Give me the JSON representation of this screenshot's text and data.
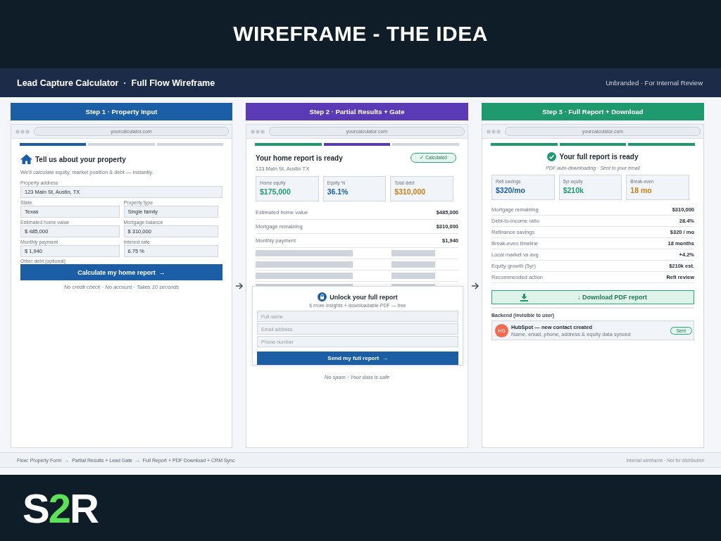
{
  "slide": {
    "title": "WIREFRAME - THE IDEA",
    "logo": [
      {
        "text": "S",
        "accent": false
      },
      {
        "text": "2",
        "accent": true
      },
      {
        "text": "R",
        "accent": false
      }
    ]
  },
  "header": {
    "title": "Lead Capture Calculator  ·  Full Flow Wireframe",
    "note": "Unbranded · For Internal Review"
  },
  "steps": [
    {
      "kind": "form",
      "title": "Step 1 · Property Input",
      "color": "#1b5ea6",
      "url": "yourcalculator.com",
      "progress": [
        {
          "color": "#1b5ea6"
        },
        {
          "color": "#d0d7e2"
        },
        {
          "color": "#d0d7e2"
        }
      ],
      "heading": "Tell us about your property",
      "subtitle": "We'll calculate equity, market position & debt — instantly.",
      "field_rows": [
        [
          {
            "label": "Property address",
            "value": "123 Main St, Austin, TX"
          }
        ],
        [
          {
            "label": "State",
            "value": "Texas"
          },
          {
            "label": "Property type",
            "value": "Single family"
          }
        ],
        [
          {
            "label": "Estimated home value",
            "value": "$ 485,000"
          },
          {
            "label": "Mortgage balance",
            "value": "$ 310,000"
          }
        ],
        [
          {
            "label": "Monthly payment",
            "value": "$ 1,940"
          },
          {
            "label": "Interest rate",
            "value": "6.75 %"
          }
        ]
      ],
      "extra_label": "Other debt (optional)",
      "button": "Calculate my home report  →",
      "note": "No credit check · No account · Takes 10 seconds"
    },
    {
      "kind": "gate",
      "title": "Step 2 · Partial Results + Gate",
      "color": "#5b3bb5",
      "url": "yourcalculator.com",
      "progress": [
        {
          "color": "#1f9a6e"
        },
        {
          "color": "#5b3bb5"
        },
        {
          "color": "#d0d7e2"
        }
      ],
      "heading": "Your home report is ready",
      "badge": "✓ Calculated",
      "address": "123 Main St, Austin TX",
      "stats": [
        {
          "label": "Home equity",
          "value": "$175,000",
          "color": "#1f9a6e"
        },
        {
          "label": "Equity %",
          "value": "36.1%",
          "color": "#1b5ea6"
        },
        {
          "label": "Total debt",
          "value": "$310,000",
          "color": "#c9821a"
        }
      ],
      "rows": [
        {
          "label": "Estimated home value",
          "value": "$485,000"
        },
        {
          "label": "Mortgage remaining",
          "value": "$310,000"
        },
        {
          "label": "Monthly payment",
          "value": "$1,940"
        }
      ],
      "gate": {
        "title": "Unlock your full report",
        "subtitle": "6 more insights + downloadable PDF — free",
        "fields": [
          {
            "placeholder": "Full name"
          },
          {
            "placeholder": "Email address"
          },
          {
            "placeholder": "Phone number"
          }
        ],
        "button": "Send my full report  →",
        "note": "No spam · Your data is safe"
      }
    },
    {
      "kind": "report",
      "title": "Step 3 · Full Report + Download",
      "color": "#1f9a6e",
      "url": "yourcalculator.com",
      "progress": [
        {
          "color": "#1f9a6e"
        },
        {
          "color": "#1f9a6e"
        },
        {
          "color": "#1f9a6e"
        }
      ],
      "heading": "Your full report is ready",
      "subtitle": "PDF auto-downloading · Sent to your email",
      "stats": [
        {
          "label": "Refi savings",
          "value": "$320/mo",
          "color": "#1b5ea6"
        },
        {
          "label": "5yr equity",
          "value": "$210k",
          "color": "#1f9a6e"
        },
        {
          "label": "Break-even",
          "value": "18 mo",
          "color": "#c9821a"
        }
      ],
      "rows": [
        {
          "label": "Mortgage remaining",
          "value": "$310,000"
        },
        {
          "label": "Debt-to-income ratio",
          "value": "28.4%"
        },
        {
          "label": "Refinance savings",
          "value": "$320 / mo"
        },
        {
          "label": "Break-even timeline",
          "value": "18 months"
        },
        {
          "label": "Local market vs avg",
          "value": "+4.2%"
        },
        {
          "label": "Equity growth (5yr)",
          "value": "$210k est."
        },
        {
          "label": "Recommended action",
          "value": "Refi review"
        }
      ],
      "download": "↓ Download PDF report",
      "backend": {
        "label": "Backend (invisible to user)",
        "avatar": "HS",
        "title": "HubSpot — new contact created",
        "detail": "Name, email, phone, address & equity data synced",
        "badge": "Sent"
      }
    }
  ],
  "footer": {
    "flow": "Flow: Property Form  →  Partial Results + Lead Gate  →  Full Report + PDF Download + CRM Sync",
    "note": "Internal wireframe · Not for distribution"
  }
}
